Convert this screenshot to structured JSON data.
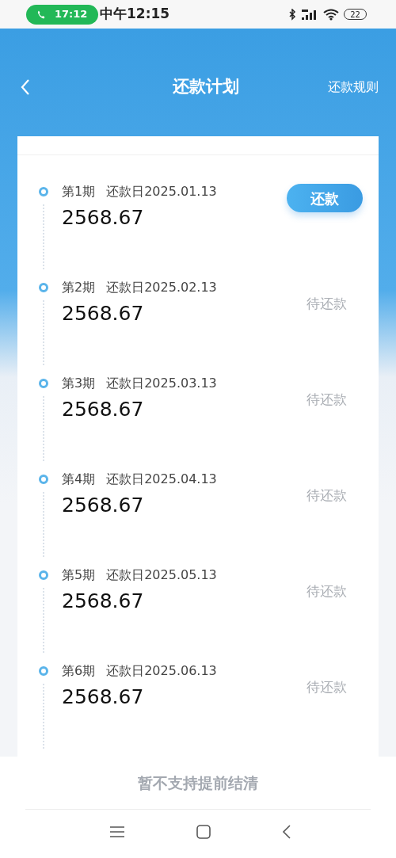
{
  "status_bar": {
    "call_time": "17:12",
    "time": "中午12:15",
    "battery": "22"
  },
  "header": {
    "title": "还款计划",
    "rule_link": "还款规则"
  },
  "installments": [
    {
      "period": "第1期",
      "due_date": "还款日2025.01.13",
      "amount": "2568.67",
      "kind": "pay",
      "status": "还款"
    },
    {
      "period": "第2期",
      "due_date": "还款日2025.02.13",
      "amount": "2568.67",
      "kind": "pending",
      "status": "待还款"
    },
    {
      "period": "第3期",
      "due_date": "还款日2025.03.13",
      "amount": "2568.67",
      "kind": "pending",
      "status": "待还款"
    },
    {
      "period": "第4期",
      "due_date": "还款日2025.04.13",
      "amount": "2568.67",
      "kind": "pending",
      "status": "待还款"
    },
    {
      "period": "第5期",
      "due_date": "还款日2025.05.13",
      "amount": "2568.67",
      "kind": "pending",
      "status": "待还款"
    },
    {
      "period": "第6期",
      "due_date": "还款日2025.06.13",
      "amount": "2568.67",
      "kind": "pending",
      "status": "待还款"
    }
  ],
  "footer_note": "暂不支持提前结清"
}
